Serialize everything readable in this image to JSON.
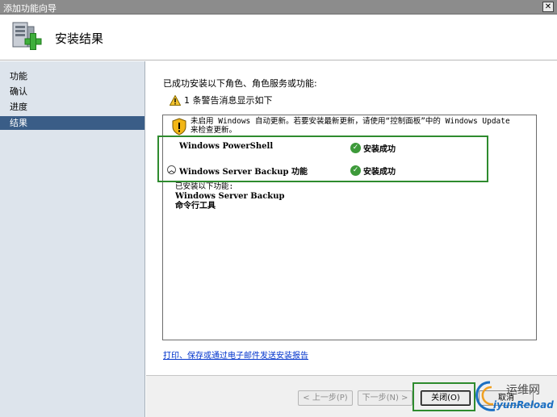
{
  "window": {
    "title": "添加功能向导",
    "close_glyph": "✕"
  },
  "header": {
    "title": "安装结果",
    "icon": "server-add-icon"
  },
  "sidebar": {
    "items": [
      {
        "label": "功能"
      },
      {
        "label": "确认"
      },
      {
        "label": "进度"
      },
      {
        "label": "结果",
        "active": true
      }
    ]
  },
  "main": {
    "intro": "已成功安装以下角色、角色服务或功能:",
    "warning_count_text": "1 条警告消息显示如下",
    "notice": {
      "line1": "未启用 Windows 自动更新。若要安装最新更新，请使用“控制面板”中的 Windows Update",
      "line2": "来检查更新。"
    },
    "results": [
      {
        "name": "Windows PowerShell",
        "status": "安装成功"
      },
      {
        "name": "Windows Server Backup 功能",
        "status": "安装成功"
      }
    ],
    "installed_header": "已安装以下功能:",
    "installed_items": [
      "Windows Server Backup",
      "命令行工具"
    ],
    "print_link": "打印、保存或通过电子邮件发送安装报告"
  },
  "footer": {
    "prev_label": "< 上一步(P)",
    "next_label": "下一步(N) >",
    "close_label": "关闭(O)",
    "cancel_label": "取消"
  },
  "watermark": {
    "cn": "运维网",
    "en": "iyunReload"
  },
  "colors": {
    "accent": "#3a5d87",
    "success": "#3d9a3a",
    "highlight": "#2e8b2e",
    "link": "#0033cc"
  }
}
